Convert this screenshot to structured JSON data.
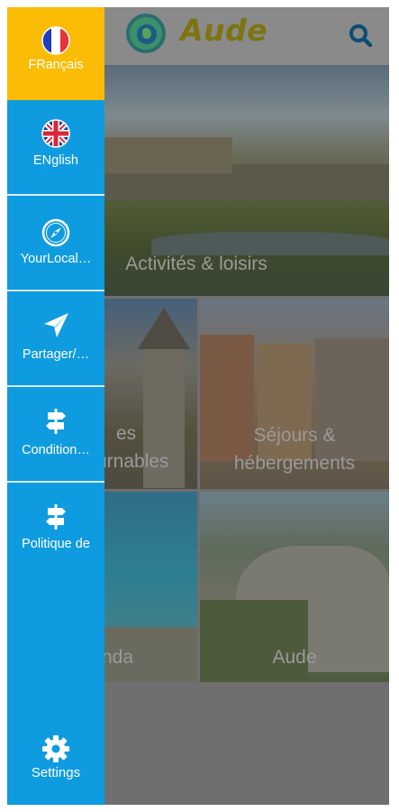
{
  "app": {
    "title": "Aude"
  },
  "drawer": {
    "items": [
      {
        "label": "FRançais",
        "icon": "france-flag-icon",
        "active": true
      },
      {
        "label": "ENglish",
        "icon": "uk-flag-icon",
        "active": false
      },
      {
        "label": "YourLocal…",
        "icon": "compass-icon",
        "active": false
      },
      {
        "label": "Partager/…",
        "icon": "send-icon",
        "active": false
      },
      {
        "label": "Condition…",
        "icon": "signpost-icon",
        "active": false
      },
      {
        "label": "Politique de",
        "icon": "signpost-icon",
        "active": false
      }
    ],
    "settings_label": "Settings"
  },
  "tiles": [
    {
      "label": "Activités & loisirs"
    },
    {
      "label_lines": [
        "es",
        "urnables"
      ]
    },
    {
      "label_lines": [
        "Séjours &",
        "hébergements"
      ]
    },
    {
      "label": "nda"
    },
    {
      "label": "Aude"
    }
  ],
  "colors": {
    "drawer": "#0f9bdf",
    "active": "#fbbc05",
    "overlay": "#6f6f6f"
  }
}
